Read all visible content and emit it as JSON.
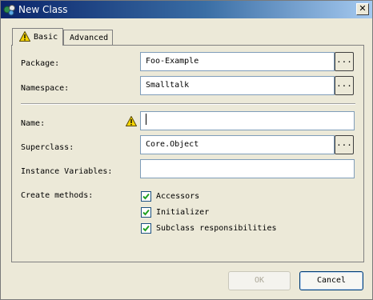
{
  "window": {
    "title": "New Class",
    "close_glyph": "✕",
    "icon": "class-wizard-icon"
  },
  "tabs": [
    {
      "label": "Basic",
      "icon": "warning-icon",
      "selected": true
    },
    {
      "label": "Advanced",
      "selected": false
    }
  ],
  "form": {
    "package": {
      "label": "Package:",
      "value": "Foo-Example",
      "browse_label": "..."
    },
    "namespace": {
      "label": "Namespace:",
      "value": "Smalltalk",
      "browse_label": "..."
    },
    "name": {
      "label": "Name:",
      "value": "",
      "icon": "warning-icon"
    },
    "superclass": {
      "label": "Superclass:",
      "value": "Core.Object",
      "browse_label": "..."
    },
    "instance_variables": {
      "label": "Instance Variables:",
      "value": ""
    },
    "create_methods": {
      "label": "Create methods:",
      "options": [
        {
          "label": "Accessors",
          "checked": true
        },
        {
          "label": "Initializer",
          "checked": true
        },
        {
          "label": "Subclass responsibilities",
          "checked": true
        }
      ]
    }
  },
  "buttons": {
    "ok_label": "OK",
    "cancel_label": "Cancel"
  },
  "colors": {
    "titlebar_start": "#0a246a",
    "titlebar_end": "#a6caf0",
    "warning_yellow": "#f5d400",
    "check_green": "#21a121"
  }
}
